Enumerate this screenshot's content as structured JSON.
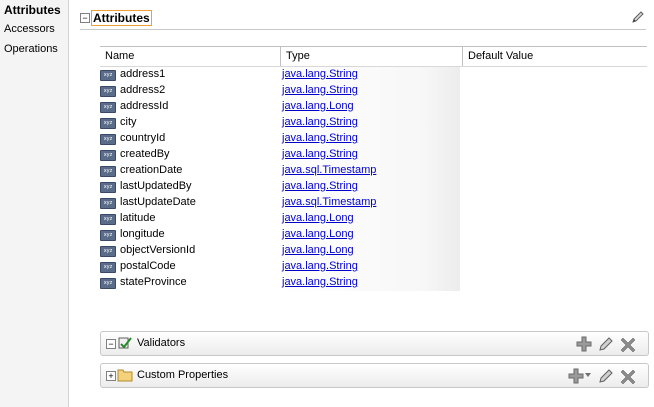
{
  "sidebar": {
    "items": [
      {
        "label": "Attributes"
      },
      {
        "label": "Accessors"
      },
      {
        "label": "Operations"
      }
    ]
  },
  "section": {
    "title": "Attributes",
    "toggle": "−"
  },
  "table": {
    "columns": [
      "Name",
      "Type",
      "Default Value"
    ],
    "rows": [
      {
        "name": "address1",
        "type": "java.lang.String"
      },
      {
        "name": "address2",
        "type": "java.lang.String"
      },
      {
        "name": "addressId",
        "type": "java.lang.Long"
      },
      {
        "name": "city",
        "type": "java.lang.String"
      },
      {
        "name": "countryId",
        "type": "java.lang.String"
      },
      {
        "name": "createdBy",
        "type": "java.lang.String"
      },
      {
        "name": "creationDate",
        "type": "java.sql.Timestamp"
      },
      {
        "name": "lastUpdatedBy",
        "type": "java.lang.String"
      },
      {
        "name": "lastUpdateDate",
        "type": "java.sql.Timestamp"
      },
      {
        "name": "latitude",
        "type": "java.lang.Long"
      },
      {
        "name": "longitude",
        "type": "java.lang.Long"
      },
      {
        "name": "objectVersionId",
        "type": "java.lang.Long"
      },
      {
        "name": "postalCode",
        "type": "java.lang.String"
      },
      {
        "name": "stateProvince",
        "type": "java.lang.String"
      }
    ]
  },
  "panels": {
    "validators": {
      "title": "Validators",
      "toggle": "−"
    },
    "custom_properties": {
      "title": "Custom Properties",
      "toggle": "+"
    }
  },
  "icons": {
    "attribute": "attribute-icon",
    "pencil": "pencil-icon",
    "add": "add-icon",
    "delete": "delete-icon",
    "validator": "validator-icon",
    "folder": "folder-icon"
  },
  "colors": {
    "link": "#0000cc",
    "title_border": "#f0a030"
  }
}
